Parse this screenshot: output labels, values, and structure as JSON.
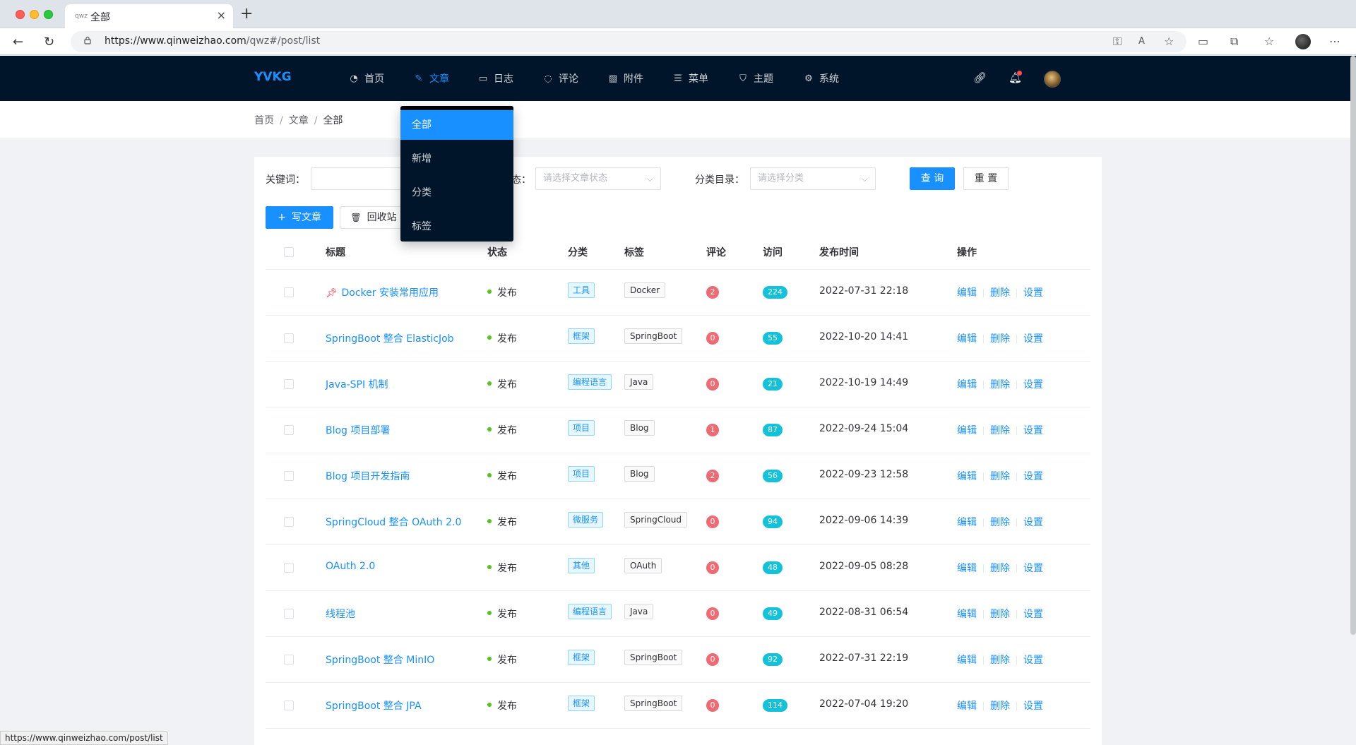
{
  "browser": {
    "tab_title": "全部",
    "tab_favicon": "qwz",
    "url_host": "https://www.qinweizhao.com",
    "url_path": "/qwz#/post/list",
    "status_url": "https://www.qinweizhao.com/post/list"
  },
  "header": {
    "logo": "YVKG",
    "menu": [
      {
        "label": "首页",
        "icon": "dashboard-icon",
        "glyph": "◔"
      },
      {
        "label": "文章",
        "icon": "edit-icon",
        "glyph": "✎"
      },
      {
        "label": "日志",
        "icon": "book-icon",
        "glyph": "▭"
      },
      {
        "label": "评论",
        "icon": "comment-icon",
        "glyph": "◌"
      },
      {
        "label": "附件",
        "icon": "picture-icon",
        "glyph": "▨"
      },
      {
        "label": "菜单",
        "icon": "menu-icon",
        "glyph": "☰"
      },
      {
        "label": "主题",
        "icon": "skin-icon",
        "glyph": "⛉"
      },
      {
        "label": "系统",
        "icon": "setting-icon",
        "glyph": "⚙"
      }
    ]
  },
  "breadcrumb": [
    "首页",
    "文章",
    "全部"
  ],
  "dropdown": [
    "全部",
    "新增",
    "分类",
    "标签"
  ],
  "filters": {
    "keyword_label": "关键词：",
    "keyword_value": "",
    "status_label": "态：",
    "status_placeholder": "请选择文章状态",
    "category_label": "分类目录：",
    "category_placeholder": "请选择分类",
    "query_btn": "查 询",
    "reset_btn": "重 置"
  },
  "actions": {
    "write_btn": "写文章",
    "trash_btn": "回收站"
  },
  "table": {
    "headers": [
      "标题",
      "状态",
      "分类",
      "标签",
      "评论",
      "访问",
      "发布时间",
      "操作"
    ],
    "ops": [
      "编辑",
      "删除",
      "设置"
    ],
    "rows": [
      {
        "title": "Docker 安装常用应用",
        "pinned": true,
        "status": "发布",
        "category": "工具",
        "tag": "Docker",
        "comments": "2",
        "visits": "224",
        "time": "2022-07-31 22:18"
      },
      {
        "title": "SpringBoot 整合 ElasticJob",
        "pinned": false,
        "status": "发布",
        "category": "框架",
        "tag": "SpringBoot",
        "comments": "0",
        "visits": "55",
        "time": "2022-10-20 14:41"
      },
      {
        "title": "Java-SPI 机制",
        "pinned": false,
        "status": "发布",
        "category": "编程语言",
        "tag": "Java",
        "comments": "0",
        "visits": "21",
        "time": "2022-10-19 14:49"
      },
      {
        "title": "Blog 项目部署",
        "pinned": false,
        "status": "发布",
        "category": "项目",
        "tag": "Blog",
        "comments": "1",
        "visits": "87",
        "time": "2022-09-24 15:04"
      },
      {
        "title": "Blog 项目开发指南",
        "pinned": false,
        "status": "发布",
        "category": "项目",
        "tag": "Blog",
        "comments": "2",
        "visits": "56",
        "time": "2022-09-23 12:58"
      },
      {
        "title": "SpringCloud 整合 OAuth 2.0",
        "pinned": false,
        "status": "发布",
        "category": "微服务",
        "tag": "SpringCloud",
        "comments": "0",
        "visits": "94",
        "time": "2022-09-06 14:39"
      },
      {
        "title": "OAuth 2.0",
        "pinned": false,
        "status": "发布",
        "category": "其他",
        "tag": "OAuth",
        "comments": "0",
        "visits": "48",
        "time": "2022-09-05 08:28"
      },
      {
        "title": "线程池",
        "pinned": false,
        "status": "发布",
        "category": "编程语言",
        "tag": "Java",
        "comments": "0",
        "visits": "49",
        "time": "2022-08-31 06:54"
      },
      {
        "title": "SpringBoot 整合 MinIO",
        "pinned": false,
        "status": "发布",
        "category": "框架",
        "tag": "SpringBoot",
        "comments": "0",
        "visits": "92",
        "time": "2022-07-31 22:19"
      },
      {
        "title": "SpringBoot 整合 JPA",
        "pinned": false,
        "status": "发布",
        "category": "框架",
        "tag": "SpringBoot",
        "comments": "0",
        "visits": "114",
        "time": "2022-07-04 19:20"
      }
    ]
  },
  "colors": {
    "header_bg": "#001529",
    "primary": "#1890ff",
    "comment_badge": "#ef6b73",
    "visit_badge": "#13c2d8",
    "status_dot": "#52c41a"
  }
}
